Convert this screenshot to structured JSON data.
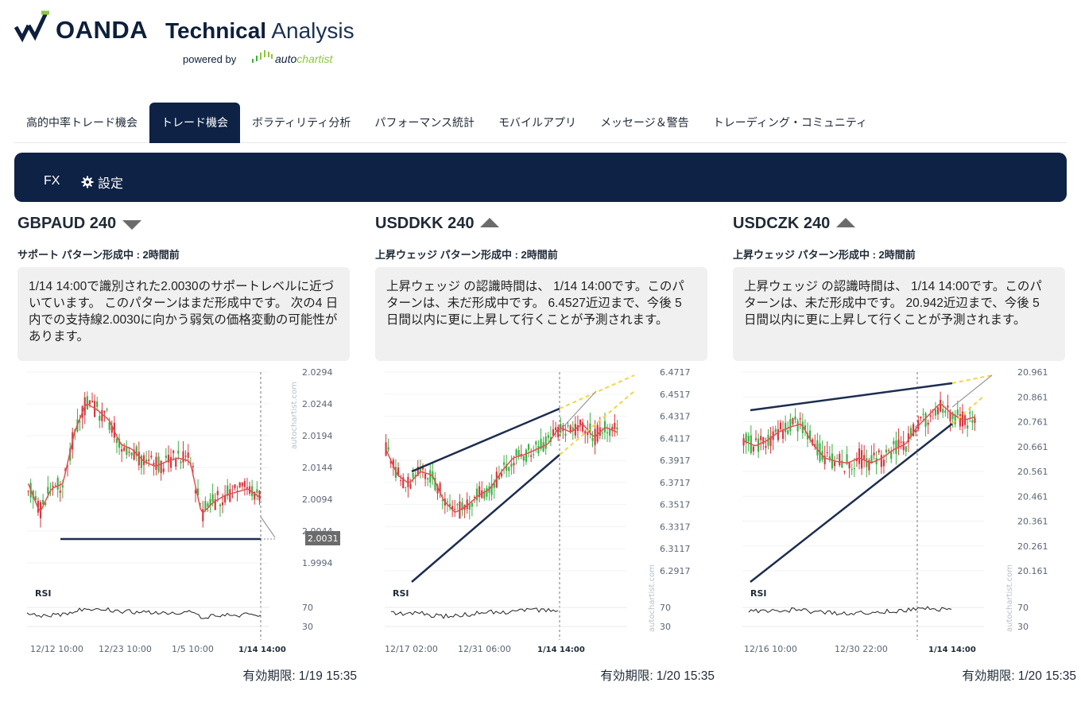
{
  "logo": {
    "brand": "OANDA",
    "product_bold": "Technical",
    "product_light": "Analysis",
    "powered_by": "powered by",
    "partner_a": "auto",
    "partner_b": "chartist"
  },
  "tabs": [
    {
      "label": "高的中率トレード機会",
      "active": false
    },
    {
      "label": "トレード機会",
      "active": true
    },
    {
      "label": "ボラティリティ分析",
      "active": false
    },
    {
      "label": "パフォーマンス統計",
      "active": false
    },
    {
      "label": "モバイルアプリ",
      "active": false
    },
    {
      "label": "メッセージ＆警告",
      "active": false
    },
    {
      "label": "トレーディング・コミュニティ",
      "active": false
    }
  ],
  "navbar": {
    "fx": "FX",
    "settings": "設定",
    "settings_icon": "gear-icon"
  },
  "colors": {
    "navy": "#0d2244",
    "candle_up": "#3cb043",
    "candle_down": "#d9363e",
    "ma_line": "#e05050",
    "pattern_line": "#1d2d4f",
    "forecast": "#f5d442",
    "arrow": "#999999"
  },
  "cards": [
    {
      "symbol": "GBPAUD 240",
      "direction": "down",
      "subtitle": "サポート パターン形成中 : 2時間前",
      "description": "1/14 14:00で識別された2.0030のサポートレベルに近づいています。 このパターンはまだ形成中です。 次の4 日内での支持線2.0030に向かう弱気の価格変動の可能性があります。",
      "expires_label": "有効期限:",
      "expires_value": "1/19 15:35",
      "chart_data": {
        "type": "candlestick",
        "y_ticks": [
          "2.0294",
          "2.0244",
          "2.0194",
          "2.0144",
          "2.0094",
          "2.0044",
          "1.9994"
        ],
        "price_marker": "2.0031",
        "x_ticks": [
          "12/12 10:00",
          "12/23 10:00",
          "1/5 10:00",
          "1/14 14:00"
        ],
        "rsi_label": "RSI",
        "rsi_levels": [
          "70",
          "30"
        ],
        "watermark": "autochartist.com"
      }
    },
    {
      "symbol": "USDDKK 240",
      "direction": "up",
      "subtitle": "上昇ウェッジ パターン形成中 : 2時間前",
      "description": "上昇ウェッジ の認識時間は、 1/14 14:00です。このパターンは、未だ形成中です。 6.4527近辺まで、今後 5 日間以内に更に上昇して行くことが予測されます。",
      "expires_label": "有効期限:",
      "expires_value": "1/20 15:35",
      "chart_data": {
        "type": "candlestick",
        "y_ticks": [
          "6.4717",
          "6.4517",
          "6.4317",
          "6.4117",
          "6.3917",
          "6.3717",
          "6.3517",
          "6.3317",
          "6.3117",
          "6.2917"
        ],
        "x_ticks": [
          "12/17 02:00",
          "12/31 06:00",
          "1/14 14:00"
        ],
        "rsi_label": "RSI",
        "rsi_levels": [
          "70",
          "30"
        ],
        "watermark": "autochartist.com"
      }
    },
    {
      "symbol": "USDCZK 240",
      "direction": "up",
      "subtitle": "上昇ウェッジ パターン形成中 : 2時間前",
      "description": "上昇ウェッジ の認識時間は、 1/14 14:00です。このパターンは、未だ形成中です。 20.942近辺まで、今後 5 日間以内に更に上昇して行くことが予測されます。",
      "expires_label": "有効期限:",
      "expires_value": "1/20 15:35",
      "chart_data": {
        "type": "candlestick",
        "y_ticks": [
          "20.961",
          "20.861",
          "20.761",
          "20.661",
          "20.561",
          "20.461",
          "20.361",
          "20.261",
          "20.161"
        ],
        "x_ticks": [
          "12/16 10:00",
          "12/30 22:00",
          "1/14 14:00"
        ],
        "rsi_label": "RSI",
        "rsi_levels": [
          "70",
          "30"
        ],
        "watermark": "autochartist.com"
      }
    }
  ]
}
